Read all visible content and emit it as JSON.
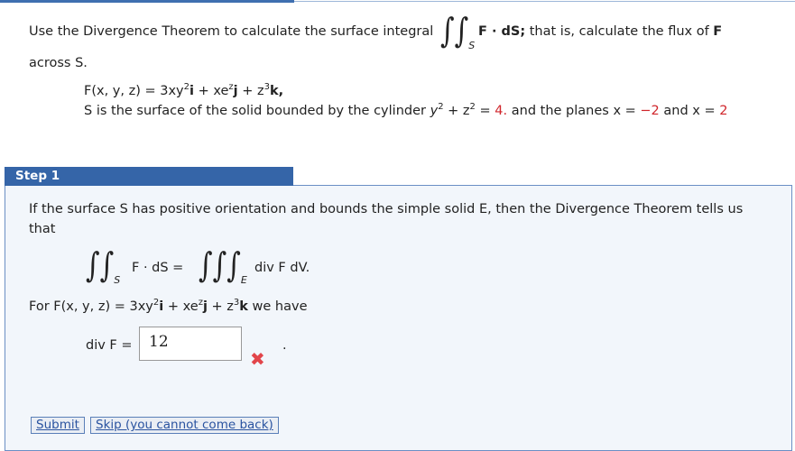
{
  "problem": {
    "intro_text": "Use the Divergence Theorem to calculate the surface integral",
    "integral_region": "S",
    "integral_integrand": "F · dS;",
    "intro_tail": "that is, calculate the flux of",
    "flux_symbol": "F",
    "across_text": "across S.",
    "field_lhs": "F(x, y, z) = 3xy",
    "field_exp1": "2",
    "field_i": "i",
    "field_mid": " + xe",
    "field_exp2": "z",
    "field_j": "j",
    "field_mid2": " + z",
    "field_exp3": "3",
    "field_k": "k,",
    "surface_text": "S is the surface of the solid bounded by the cylinder",
    "cyl_y": "y",
    "cyl_e1": "2",
    "cyl_plus": " + z",
    "cyl_e2": "2",
    "cyl_eq": " = ",
    "cyl_value": "4.",
    "planes_text": "and the planes",
    "plane1_lhs": "x = ",
    "plane1_value": "−2",
    "and_text": "and",
    "plane2_lhs": "x = ",
    "plane2_value": "2"
  },
  "step": {
    "tab_label": "Step 1",
    "text_line1": "If the surface S has positive orientation and bounds the simple solid E, then the Divergence Theorem tells us",
    "text_line2": "that",
    "lhs_region": "S",
    "lhs_integrand": "F · dS =",
    "rhs_region": "E",
    "rhs_integrand": "div F dV.",
    "for_text": "For",
    "for_field": "F(x, y, z) = 3xy",
    "for_e1": "2",
    "for_i": "i",
    "for_mid": " + xe",
    "for_e2": "z",
    "for_j": "j",
    "for_mid2": " + z",
    "for_e3": "3",
    "for_k": "k",
    "we_have": "we have",
    "div_label": "div F =",
    "div_value": "12",
    "period": ".",
    "wrong_mark": "✖"
  },
  "buttons": {
    "submit": "Submit",
    "skip": "Skip (you cannot come back)"
  },
  "colors": {
    "accent": "#3565a8",
    "red": "#d0262c",
    "wrong": "#e2454a"
  }
}
